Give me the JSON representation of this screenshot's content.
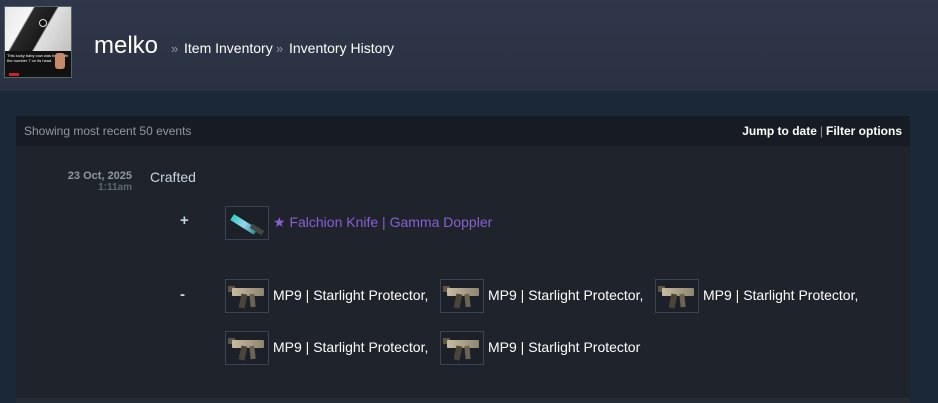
{
  "header": {
    "profile_name": "melko",
    "breadcrumb_sep": "»",
    "breadcrumbs": [
      "Item Inventory",
      "Inventory History"
    ],
    "avatar_caption": "This lucky baby cow was born with the number 7 on its head."
  },
  "history": {
    "showing_text": "Showing most recent 50 events",
    "jump_to_date": "Jump to date",
    "divider": "|",
    "filter_options": "Filter options"
  },
  "event": {
    "date": "23 Oct, 2025",
    "time": "1:11am",
    "description": "Crafted",
    "received_sign": "+",
    "lost_sign": "-",
    "received_items": [
      {
        "name": "★ Falchion Knife | Gamma Doppler",
        "icon": "falchion-knife-icon",
        "color": "#8a5fd4"
      }
    ],
    "lost_items": [
      {
        "name": "MP9 | Starlight Protector,",
        "icon": "mp9-icon"
      },
      {
        "name": "MP9 | Starlight Protector,",
        "icon": "mp9-icon"
      },
      {
        "name": "MP9 | Starlight Protector,",
        "icon": "mp9-icon"
      },
      {
        "name": "MP9 | Starlight Protector,",
        "icon": "mp9-icon"
      },
      {
        "name": "MP9 | Starlight Protector",
        "icon": "mp9-icon"
      }
    ]
  },
  "colors": {
    "background": "#1b2838",
    "header": "#2e3546",
    "panel": "#1e232c",
    "covert_purple": "#8a5fd4"
  }
}
